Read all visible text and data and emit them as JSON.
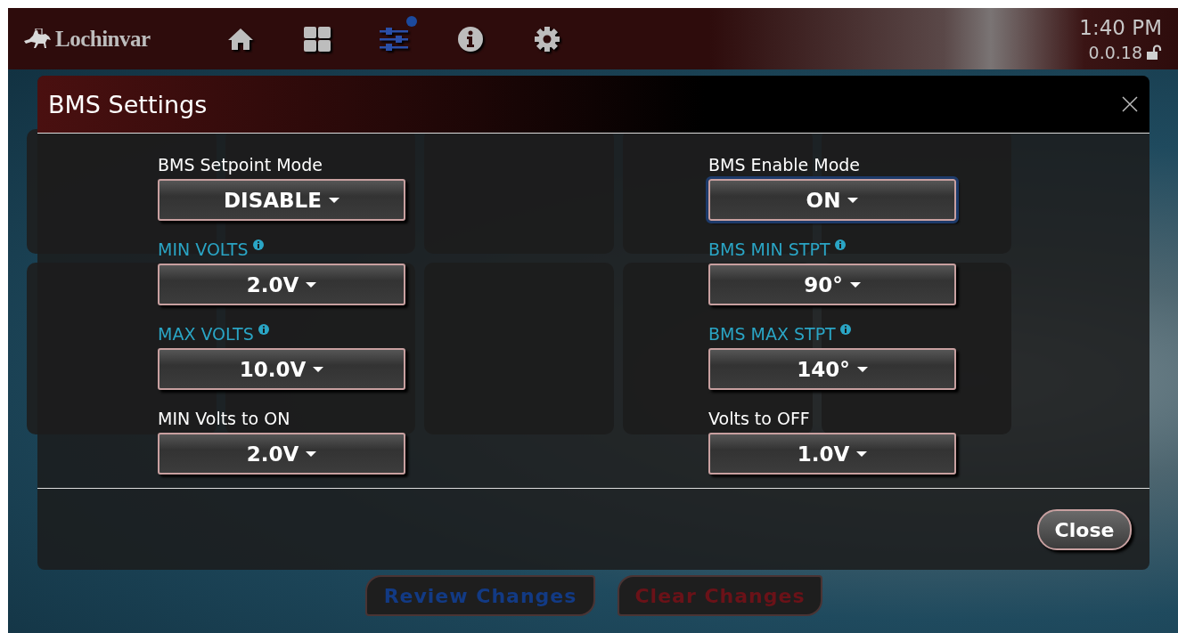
{
  "header": {
    "logo": "Lochinvar",
    "nav": [
      {
        "kind": "home",
        "selected": false,
        "badge": false
      },
      {
        "kind": "grid",
        "selected": false,
        "badge": false
      },
      {
        "kind": "sliders",
        "selected": true,
        "badge": true
      },
      {
        "kind": "info",
        "selected": false,
        "badge": false
      },
      {
        "kind": "gear",
        "selected": false,
        "badge": false
      }
    ],
    "time": "1:40 PM",
    "version": "0.0.18",
    "locked": false
  },
  "dialog": {
    "title": "BMS Settings",
    "columns": [
      [
        {
          "label": "BMS Setpoint Mode",
          "info": false,
          "value": "DISABLE",
          "focused": false
        },
        {
          "label": "MIN VOLTS",
          "info": true,
          "value": "2.0V",
          "focused": false
        },
        {
          "label": "MAX VOLTS",
          "info": true,
          "value": "10.0V",
          "focused": false
        },
        {
          "label": "MIN Volts to ON",
          "info": false,
          "value": "2.0V",
          "focused": false
        }
      ],
      [
        {
          "label": "BMS Enable Mode",
          "info": false,
          "value": "ON",
          "focused": true
        },
        {
          "label": "BMS MIN STPT",
          "info": true,
          "value": "90°",
          "focused": false
        },
        {
          "label": "BMS MAX STPT",
          "info": true,
          "value": "140°",
          "focused": false
        },
        {
          "label": "Volts to OFF",
          "info": false,
          "value": "1.0V",
          "focused": false
        }
      ]
    ],
    "close_button": "Close"
  },
  "bottom_buttons": [
    {
      "label": "Review Changes",
      "kind": "review"
    },
    {
      "label": "Clear Changes",
      "kind": "clear"
    }
  ]
}
